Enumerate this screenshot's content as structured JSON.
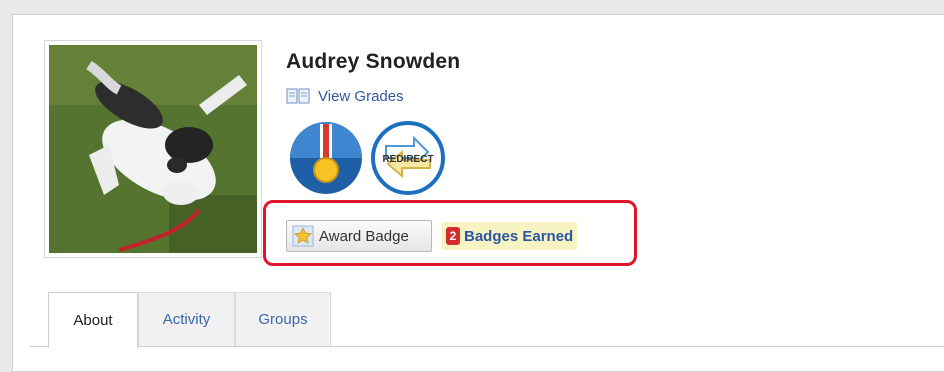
{
  "profile": {
    "name": "Audrey Snowden",
    "view_grades_label": "View Grades",
    "photo_icon": "dog-photo",
    "badges": [
      {
        "icon": "medal-badge-icon"
      },
      {
        "icon": "redirect-badge-icon",
        "text": "REDIRECT"
      }
    ]
  },
  "actions": {
    "award_badge_label": "Award Badge",
    "badges_earned_count": "2",
    "badges_earned_label": "Badges Earned"
  },
  "tabs": [
    {
      "label": "About",
      "active": true
    },
    {
      "label": "Activity",
      "active": false
    },
    {
      "label": "Groups",
      "active": false
    }
  ],
  "colors": {
    "link": "#2f5aa0",
    "highlight_border": "#e0152a",
    "earned_background": "#f7f3c2",
    "count_badge": "#d42b2b"
  }
}
